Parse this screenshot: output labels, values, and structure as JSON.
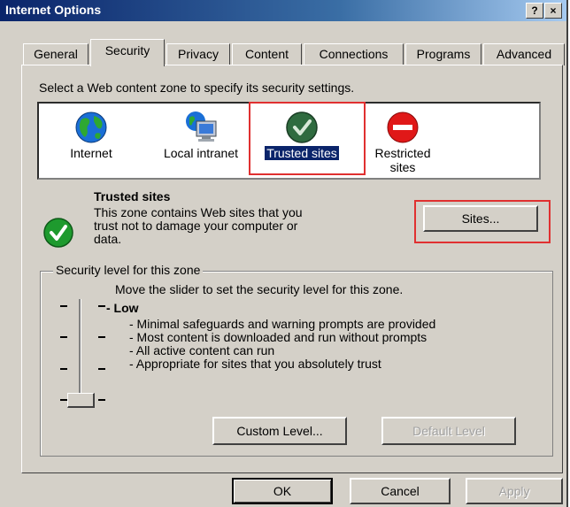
{
  "window": {
    "title": "Internet Options",
    "help_button": "?",
    "close_button": "×"
  },
  "tabs": [
    {
      "label": "General",
      "active": false
    },
    {
      "label": "Security",
      "active": true
    },
    {
      "label": "Privacy",
      "active": false
    },
    {
      "label": "Content",
      "active": false
    },
    {
      "label": "Connections",
      "active": false
    },
    {
      "label": "Programs",
      "active": false
    },
    {
      "label": "Advanced",
      "active": false
    }
  ],
  "security": {
    "select_prompt": "Select a Web content zone to specify its security settings.",
    "zones": [
      {
        "label": "Internet",
        "icon": "globe-icon",
        "selected": false
      },
      {
        "label": "Local intranet",
        "icon": "computer-globe-icon",
        "selected": false
      },
      {
        "label": "Trusted sites",
        "icon": "checkmark-icon",
        "selected": true
      },
      {
        "label": "Restricted\nsites",
        "icon": "no-entry-icon",
        "selected": false
      }
    ],
    "zone_info": {
      "title": "Trusted sites",
      "desc_line1": "This zone contains Web sites that you",
      "desc_line2": "trust not to damage your computer or",
      "desc_line3": "data."
    },
    "sites_button": "Sites...",
    "level_group_label": "Security level for this zone",
    "slider_instruction": "Move the slider to set the security level for this zone.",
    "level_name": "- Low",
    "level_bullets": [
      "- Minimal safeguards and warning prompts are provided",
      "- Most content is downloaded and run without prompts",
      "- All active content can run",
      "- Appropriate for sites that you absolutely trust"
    ],
    "slider_level": "Low",
    "custom_level_button": "Custom Level...",
    "default_level_button": "Default Level"
  },
  "footer": {
    "ok": "OK",
    "cancel": "Cancel",
    "apply": "Apply"
  },
  "colors": {
    "titlebar": "#0a246a",
    "highlight_red": "#e03030",
    "selection": "#0a246a"
  }
}
